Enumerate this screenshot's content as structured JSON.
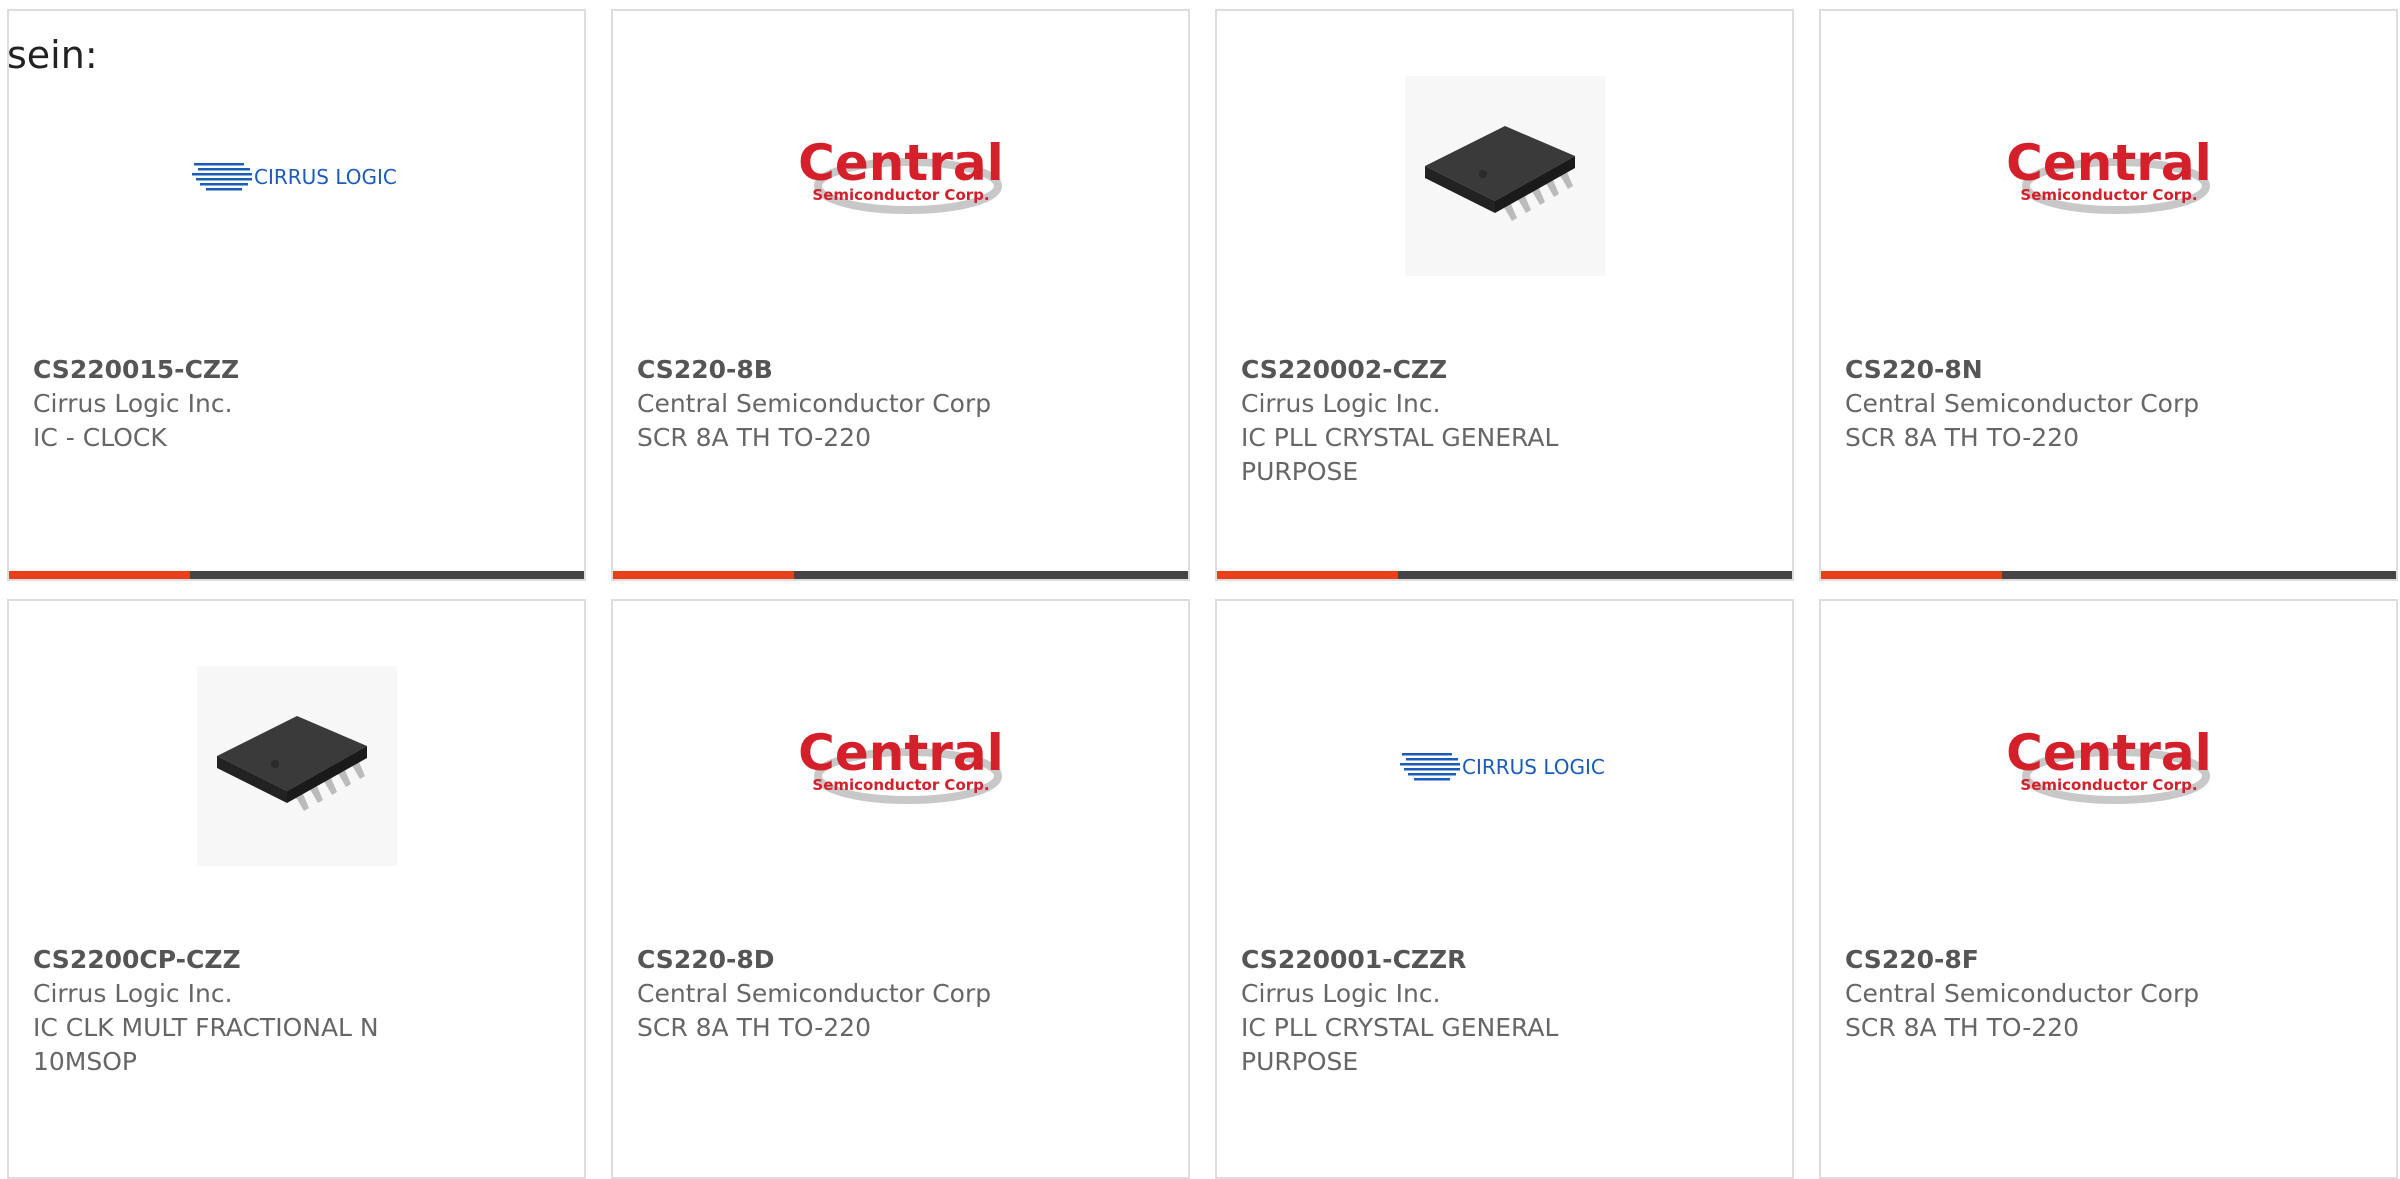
{
  "intro": {
    "text": "sein:"
  },
  "colors": {
    "accent": "#e8401a",
    "bar": "#444444",
    "border": "#dddddd",
    "text": "#666666"
  },
  "products": [
    {
      "part_number": "CS220015-CZZ",
      "manufacturer": "Cirrus Logic Inc.",
      "description": "IC - CLOCK",
      "image": "cirrus-logic-logo",
      "logo_text": "CIRRUS LOGIC"
    },
    {
      "part_number": "CS220-8B",
      "manufacturer": "Central Semiconductor Corp",
      "description": "SCR 8A TH TO-220",
      "image": "central-semiconductor-logo",
      "logo_text": "Central",
      "logo_subtext": "Semiconductor Corp."
    },
    {
      "part_number": "CS220002-CZZ",
      "manufacturer": "Cirrus Logic Inc.",
      "description": "IC PLL CRYSTAL GENERAL PURPOSE",
      "image": "msop-chip-photo"
    },
    {
      "part_number": "CS220-8N",
      "manufacturer": "Central Semiconductor Corp",
      "description": "SCR 8A TH TO-220",
      "image": "central-semiconductor-logo",
      "logo_text": "Central",
      "logo_subtext": "Semiconductor Corp."
    },
    {
      "part_number": "CS2200CP-CZZ",
      "manufacturer": "Cirrus Logic Inc.",
      "description": "IC CLK MULT FRACTIONAL N 10MSOP",
      "image": "msop-chip-photo"
    },
    {
      "part_number": "CS220-8D",
      "manufacturer": "Central Semiconductor Corp",
      "description": "SCR 8A TH TO-220",
      "image": "central-semiconductor-logo",
      "logo_text": "Central",
      "logo_subtext": "Semiconductor Corp."
    },
    {
      "part_number": "CS220001-CZZR",
      "manufacturer": "Cirrus Logic Inc.",
      "description": "IC PLL CRYSTAL GENERAL PURPOSE",
      "image": "cirrus-logic-logo",
      "logo_text": "CIRRUS LOGIC"
    },
    {
      "part_number": "CS220-8F",
      "manufacturer": "Central Semiconductor Corp",
      "description": "SCR 8A TH TO-220",
      "image": "central-semiconductor-logo",
      "logo_text": "Central",
      "logo_subtext": "Semiconductor Corp."
    }
  ]
}
